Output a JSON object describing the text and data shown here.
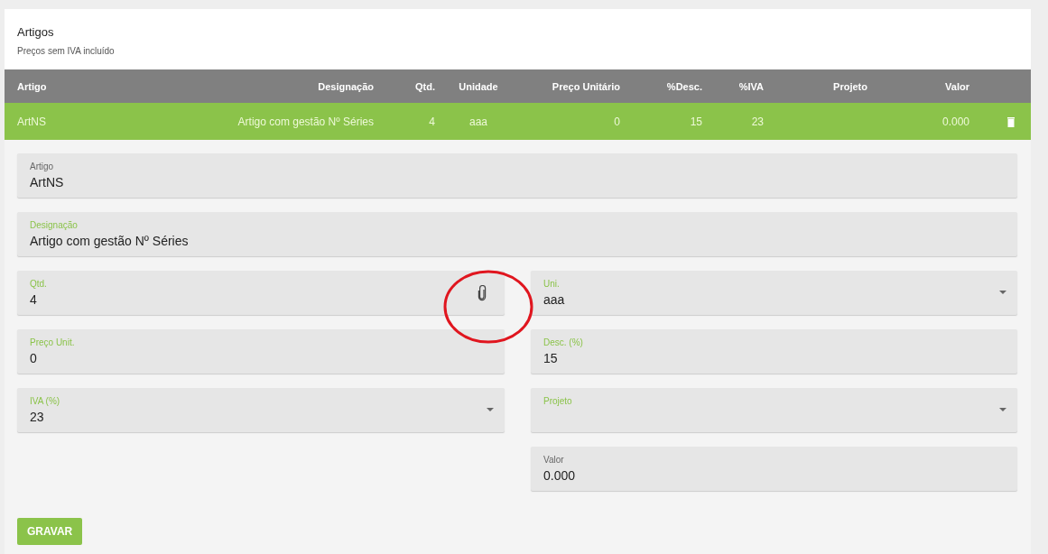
{
  "card": {
    "title": "Artigos",
    "subtitle": "Preços sem IVA incluído"
  },
  "table": {
    "columns": [
      "Artigo",
      "Designação",
      "Qtd.",
      "Unidade",
      "Preço Unitário",
      "%Desc.",
      "%IVA",
      "Projeto",
      "Valor"
    ],
    "rows": [
      {
        "selected": true,
        "cells": [
          "ArtNS",
          "Artigo com gestão Nº Séries",
          "4",
          "aaa",
          "0",
          "15",
          "23",
          null,
          "0.000"
        ]
      }
    ]
  },
  "form": {
    "wide_fields": [
      {
        "label": "Artigo",
        "value": "ArtNS",
        "readonly": true
      },
      {
        "label": "Designação",
        "value": "Artigo com gestão Nº Séries",
        "readonly": false
      }
    ],
    "field_rows": [
      {
        "left": {
          "label": "Qtd.",
          "value": "4",
          "kind": "text",
          "readonly": false,
          "attachment": true
        },
        "right": {
          "label": "Uni.",
          "value": "aaa",
          "kind": "select",
          "readonly": false
        }
      },
      {
        "left": {
          "label": "Preço Unit.",
          "value": "0",
          "kind": "text",
          "readonly": false
        },
        "right": {
          "label": "Desc. (%)",
          "value": "15",
          "kind": "text",
          "readonly": false
        }
      },
      {
        "left": {
          "label": "IVA (%)",
          "value": "23",
          "kind": "select",
          "readonly": false
        },
        "right": {
          "label": "Projeto",
          "kind": "select",
          "readonly": false
        }
      },
      {
        "right": {
          "label": "Valor",
          "value": "0.000",
          "kind": "text",
          "readonly": true
        }
      }
    ],
    "save_button": "GRAVAR"
  }
}
